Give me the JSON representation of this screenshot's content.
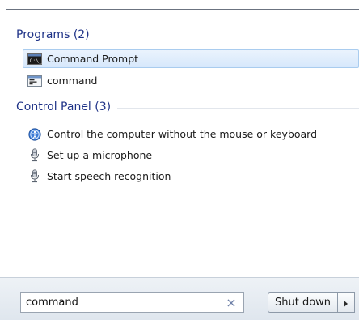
{
  "groups": [
    {
      "title": "Programs (2)",
      "items": [
        {
          "label": "Command Prompt",
          "icon": "cmd-icon",
          "selected": true
        },
        {
          "label": "command",
          "icon": "dos-app-icon",
          "selected": false
        }
      ]
    },
    {
      "title": "Control Panel (3)",
      "items": [
        {
          "label": "Control the computer without the mouse or keyboard",
          "icon": "ease-of-access-icon",
          "selected": false
        },
        {
          "label": "Set up a microphone",
          "icon": "microphone-icon",
          "selected": false
        },
        {
          "label": "Start speech recognition",
          "icon": "microphone-icon",
          "selected": false
        }
      ]
    }
  ],
  "search": {
    "value": "command",
    "clear_glyph": "×"
  },
  "shutdown": {
    "label": "Shut down"
  },
  "colors": {
    "header_text": "#1e3287",
    "selection_bg": "#d7e8fc",
    "selection_border": "#a9ccef"
  }
}
